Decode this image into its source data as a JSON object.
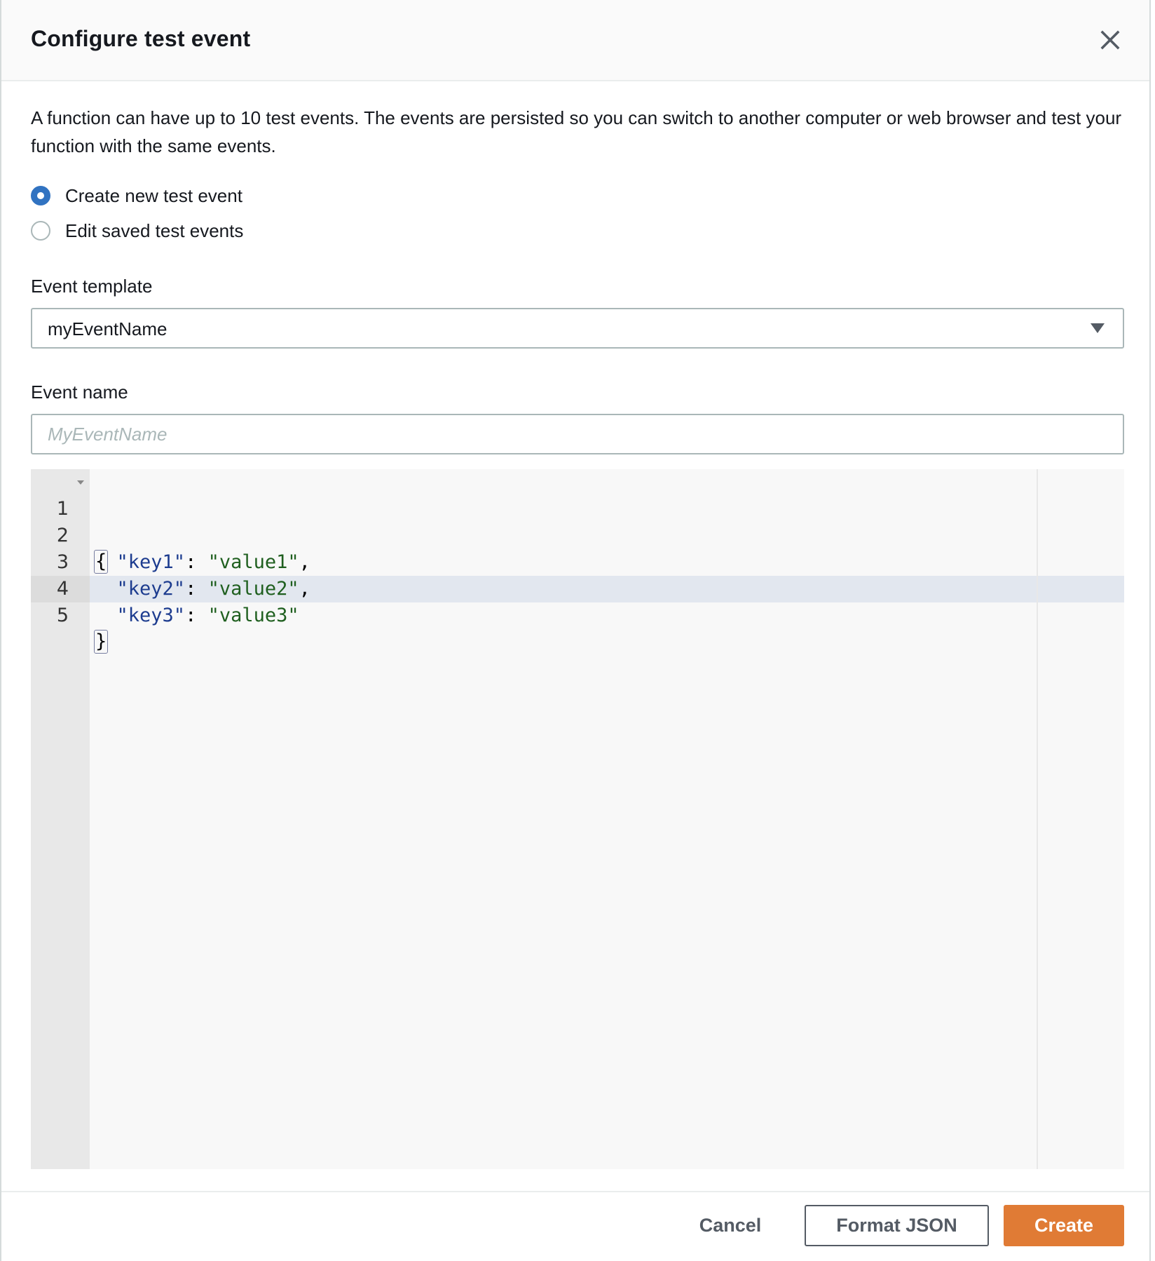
{
  "dialog": {
    "title": "Configure test event",
    "close_icon": "close-icon",
    "description": "A function can have up to 10 test events. The events are persisted so you can switch to another computer or web browser and test your function with the same events."
  },
  "mode": {
    "options": [
      {
        "label": "Create new test event",
        "selected": true
      },
      {
        "label": "Edit saved test events",
        "selected": false
      }
    ]
  },
  "event_template": {
    "label": "Event template",
    "value": "myEventName",
    "caret_icon": "caret-down-icon"
  },
  "event_name": {
    "label": "Event name",
    "value": "",
    "placeholder": "MyEventName"
  },
  "editor": {
    "active_line": 5,
    "lines": [
      {
        "num": "1",
        "indent": "",
        "key": "",
        "colon": "",
        "value": "",
        "punct": "{",
        "fold": true
      },
      {
        "num": "2",
        "indent": "  ",
        "key": "\"key1\"",
        "colon": ": ",
        "value": "\"value1\"",
        "punct": ",",
        "fold": false
      },
      {
        "num": "3",
        "indent": "  ",
        "key": "\"key2\"",
        "colon": ": ",
        "value": "\"value2\"",
        "punct": ",",
        "fold": false
      },
      {
        "num": "4",
        "indent": "  ",
        "key": "\"key3\"",
        "colon": ": ",
        "value": "\"value3\"",
        "punct": "",
        "fold": false
      },
      {
        "num": "5",
        "indent": "",
        "key": "",
        "colon": "",
        "value": "",
        "punct": "}",
        "fold": false
      }
    ]
  },
  "footer": {
    "cancel_label": "Cancel",
    "format_label": "Format JSON",
    "create_label": "Create"
  },
  "colors": {
    "primary": "#e07b35",
    "radio_selected": "#3173c1",
    "json_key": "#1d3c8f",
    "json_string": "#1f5f1f"
  }
}
